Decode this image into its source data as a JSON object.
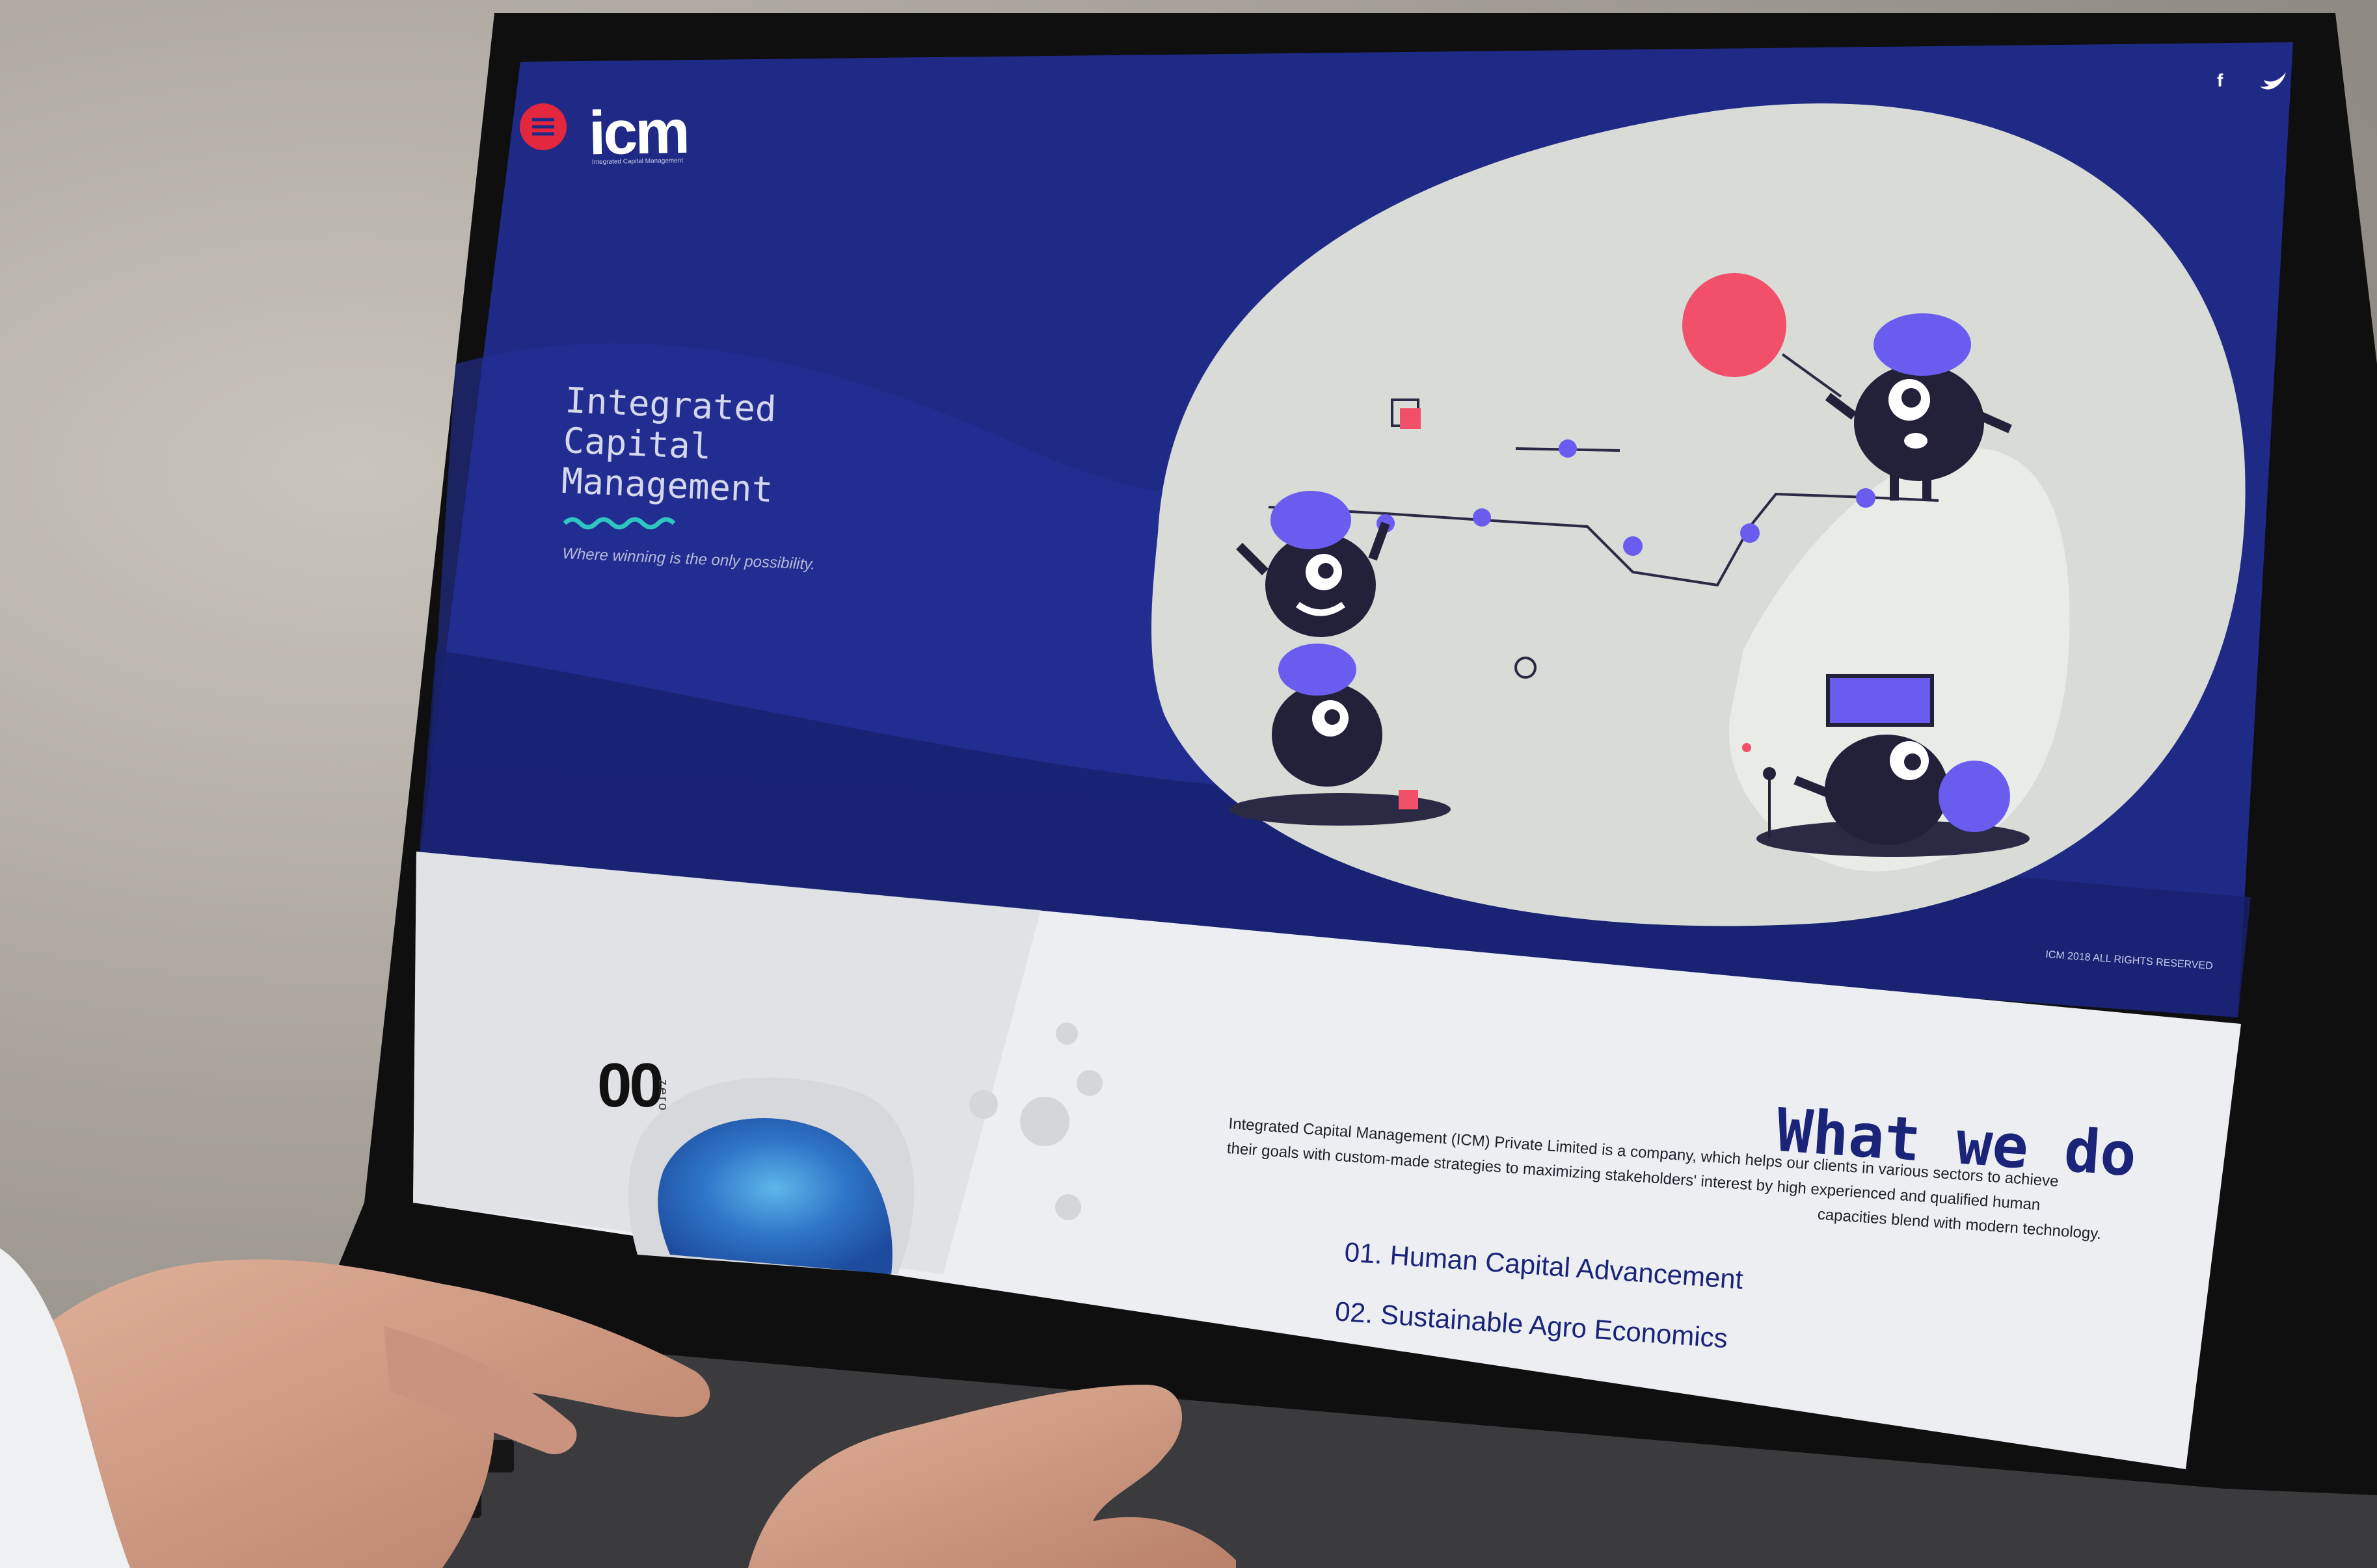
{
  "brand": {
    "logo_text": "icm",
    "logo_tagline": "Integrated Capital Management"
  },
  "hero": {
    "title_line1": "Integrated",
    "title_line2": "Capital",
    "title_line3": "Management",
    "tagline": "Where winning is the only possibility.",
    "copyright": "ICM 2018 ALL RIGHTS RESERVED"
  },
  "social": {
    "facebook": "f"
  },
  "section": {
    "number": "00",
    "number_word": "zero",
    "heading": "What we do",
    "body_line1": "Integrated Capital Management (ICM) Private Limited is a company, which helps our clients in various sectors to achieve",
    "body_line2": "their goals with custom-made strategies to maximizing stakeholders' interest by high experienced and qualified human",
    "body_line3": "capacities blend with modern technology.",
    "items": [
      "01. Human Capital Advancement",
      "02. Sustainable Agro Economics"
    ]
  },
  "colors": {
    "hero_bg": "#1f2a86",
    "blob": "#d8dbd6",
    "blob_shadow": "#f0877f",
    "accent_purple": "#6b5cf0",
    "accent_red": "#f2506a",
    "character": "#23213a",
    "heading_navy": "#1a2478",
    "wave_teal": "#2fc6c1"
  },
  "icons": [
    "menu-icon",
    "facebook-icon",
    "twitter-icon"
  ]
}
